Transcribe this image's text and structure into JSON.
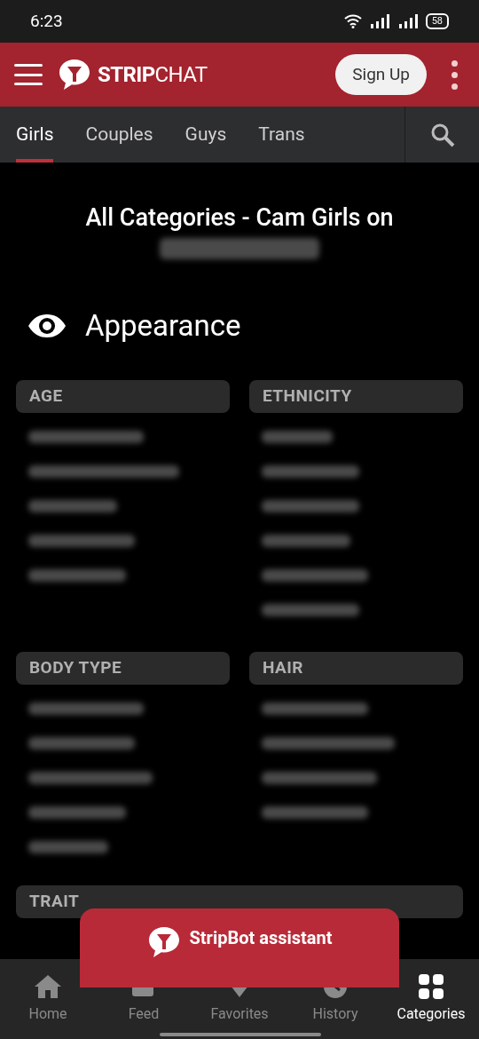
{
  "status_bar": {
    "time": "6:23",
    "battery": "58"
  },
  "header": {
    "brand_bold": "STRIP",
    "brand_light": "CHAT",
    "sign_up": "Sign Up"
  },
  "tabs": [
    {
      "label": "Girls",
      "selected": true
    },
    {
      "label": "Couples",
      "selected": false
    },
    {
      "label": "Guys",
      "selected": false
    },
    {
      "label": "Trans",
      "selected": false
    }
  ],
  "title": "All Categories - Cam Girls on",
  "title_continued": {
    "kind": "blurred"
  },
  "section": {
    "title": "Appearance"
  },
  "groups": [
    {
      "title": "AGE",
      "items": [
        {
          "kind": "blurred"
        },
        {
          "kind": "blurred"
        },
        {
          "kind": "blurred"
        },
        {
          "kind": "blurred"
        },
        {
          "kind": "blurred"
        }
      ]
    },
    {
      "title": "ETHNICITY",
      "items": [
        {
          "kind": "blurred"
        },
        {
          "kind": "blurred"
        },
        {
          "kind": "blurred"
        },
        {
          "kind": "blurred"
        },
        {
          "kind": "blurred"
        },
        {
          "kind": "blurred"
        }
      ]
    },
    {
      "title": "BODY TYPE",
      "items": [
        {
          "kind": "blurred"
        },
        {
          "kind": "blurred"
        },
        {
          "kind": "blurred"
        },
        {
          "kind": "blurred"
        },
        {
          "kind": "blurred"
        }
      ]
    },
    {
      "title": "HAIR",
      "items": [
        {
          "kind": "blurred"
        },
        {
          "kind": "blurred"
        },
        {
          "kind": "blurred"
        },
        {
          "kind": "blurred"
        }
      ]
    }
  ],
  "next_group": {
    "title": "TRAIT"
  },
  "assistant": {
    "label": "StripBot assistant"
  },
  "bottom_nav": [
    {
      "label": "Home",
      "selected": false
    },
    {
      "label": "Feed",
      "selected": false
    },
    {
      "label": "Favorites",
      "selected": false
    },
    {
      "label": "History",
      "selected": false
    },
    {
      "label": "Categories",
      "selected": true
    }
  ]
}
